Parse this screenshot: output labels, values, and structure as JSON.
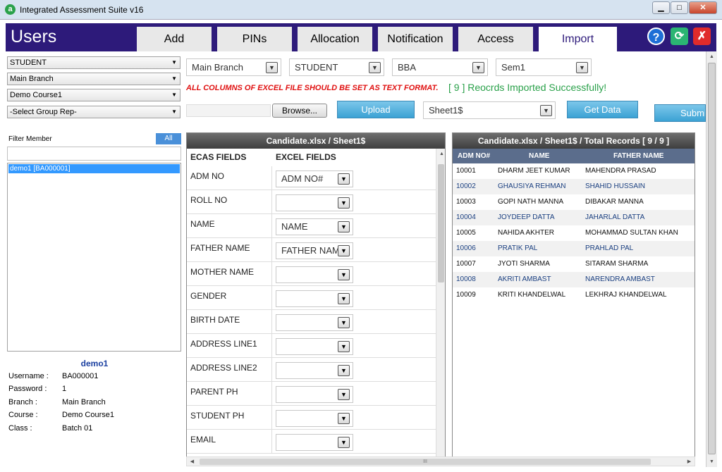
{
  "window": {
    "title": "Integrated Assessment Suite v16",
    "app_icon": "a",
    "minimize": "▁",
    "maximize": "□",
    "close": "✕"
  },
  "header": {
    "title": "Users",
    "tabs": [
      "Add",
      "PINs",
      "Allocation",
      "Notification",
      "Access",
      "Import"
    ],
    "active_tab": "Import",
    "help_icon": "?",
    "refresh_icon": "⟳",
    "exit_icon": "✗"
  },
  "left": {
    "selects": [
      "STUDENT",
      "Main Branch",
      "Demo Course1",
      "-Select Group Rep-"
    ],
    "filter_label": "Filter Member",
    "all_button": "All",
    "member_list": [
      "demo1 [BA000001]"
    ],
    "selected_name": "demo1",
    "info": [
      {
        "key": "Username :",
        "val": "BA000001"
      },
      {
        "key": "Password :",
        "val": "1"
      },
      {
        "key": "Branch :",
        "val": "Main Branch"
      },
      {
        "key": "Course :",
        "val": "Demo Course1"
      },
      {
        "key": "Class :",
        "val": "Batch 01"
      }
    ]
  },
  "filters": [
    "Main Branch",
    "STUDENT",
    "BBA",
    "Sem1"
  ],
  "dropdown_arrow": "▼",
  "warning": "ALL COLUMNS OF EXCEL FILE SHOULD BE SET AS TEXT FORMAT.",
  "success": "[ 9 ] Reocrds Imported Successfully!",
  "actions": {
    "browse": "Browse...",
    "upload": "Upload",
    "sheet": "Sheet1$",
    "get_data": "Get Data",
    "submit": "Submit"
  },
  "mapping": {
    "header": "Candidate.xlsx / Sheet1$",
    "col_fields": "ECAS FIELDS",
    "col_excel": "EXCEL FIELDS",
    "rows": [
      {
        "field": "ADM NO",
        "value": "ADM NO#"
      },
      {
        "field": "ROLL NO",
        "value": ""
      },
      {
        "field": "NAME",
        "value": "NAME"
      },
      {
        "field": "FATHER NAME",
        "value": "FATHER NAME"
      },
      {
        "field": "MOTHER NAME",
        "value": ""
      },
      {
        "field": "GENDER",
        "value": ""
      },
      {
        "field": "BIRTH DATE",
        "value": ""
      },
      {
        "field": "ADDRESS LINE1",
        "value": ""
      },
      {
        "field": "ADDRESS LINE2",
        "value": ""
      },
      {
        "field": "PARENT PH",
        "value": ""
      },
      {
        "field": "STUDENT PH",
        "value": ""
      },
      {
        "field": "EMAIL",
        "value": ""
      }
    ]
  },
  "records": {
    "header": "Candidate.xlsx / Sheet1$ / Total Records [ 9 / 9 ]",
    "columns": [
      "ADM NO#",
      "NAME",
      "FATHER NAME"
    ],
    "rows": [
      [
        "10001",
        "DHARM JEET KUMAR",
        "MAHENDRA PRASAD"
      ],
      [
        "10002",
        "GHAUSIYA REHMAN",
        "SHAHID HUSSAIN"
      ],
      [
        "10003",
        "GOPI NATH MANNA",
        "DIBAKAR MANNA"
      ],
      [
        "10004",
        "JOYDEEP DATTA",
        "JAHARLAL DATTA"
      ],
      [
        "10005",
        "NAHIDA AKHTER",
        "MOHAMMAD SULTAN KHAN"
      ],
      [
        "10006",
        "PRATIK PAL",
        "PRAHLAD PAL"
      ],
      [
        "10007",
        "JYOTI SHARMA",
        "SITARAM SHARMA"
      ],
      [
        "10008",
        "AKRITI AMBAST",
        "NARENDRA AMBAST"
      ],
      [
        "10009",
        "KRITI KHANDELWAL",
        "LEKHRAJ KHANDELWAL"
      ]
    ]
  },
  "scroll": {
    "up": "▲",
    "down": "▼",
    "left": "◀",
    "right": "▶",
    "grip": "III"
  },
  "colors": {
    "header_bg": "#2d1a7a",
    "accent_blue": "#3ba2d4",
    "warning": "#e01010",
    "success": "#2aa14a",
    "record_text": "#1a3f80"
  }
}
